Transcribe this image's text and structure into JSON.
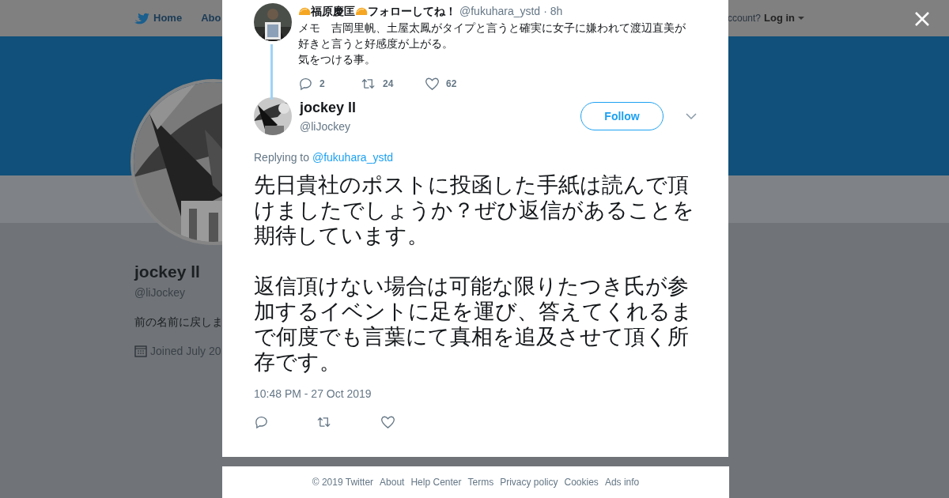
{
  "background_page": {
    "nav_items": [
      "Home",
      "Abo"
    ],
    "account_prompt": "ccount?",
    "login": "Log in",
    "profile": {
      "name": "jockey ll",
      "handle": "@liJockey",
      "bio": "前の名前に戻しま",
      "joined": "Joined July 20"
    }
  },
  "parent_tweet": {
    "name_parts": [
      "福原慶匡",
      "フォローしてね！"
    ],
    "handle": "@fukuhara_ystd",
    "time": "· 8h",
    "text_lines": [
      "メモ　吉岡里帆、土屋太鳳がタイプと言うと確実に女子に嫌われて渡辺直美が好きと言うと好感度が上がる。",
      "気をつける事。"
    ],
    "replies": "2",
    "retweets": "24",
    "likes": "62"
  },
  "main_tweet": {
    "name": "jockey ll",
    "handle": "@liJockey",
    "follow": "Follow",
    "replying_label": "Replying to",
    "reply_to": "@fukuhara_ystd",
    "paragraphs": [
      "先日貴社のポストに投函した手紙は読んで頂けましたでしょうか？ぜひ返信があることを期待しています。",
      "返信頂けない場合は可能な限りたつき氏が参加するイベントに足を運び、答えてくれるまで何度でも言葉にて真相を追及させて頂く所存です。"
    ],
    "timestamp": "10:48 PM - 27 Oct 2019"
  },
  "footer": [
    "© 2019 Twitter",
    "About",
    "Help Center",
    "Terms",
    "Privacy policy",
    "Cookies",
    "Ads info"
  ]
}
